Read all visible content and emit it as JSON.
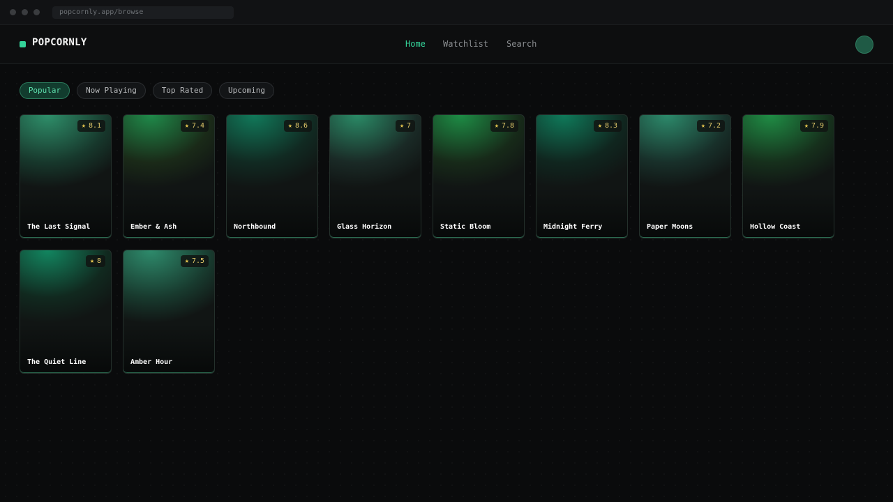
{
  "browser": {
    "url": "popcornly.app/browse"
  },
  "app": {
    "name": "POPCORNLY",
    "accent": "#34d399"
  },
  "nav": {
    "home": "Home",
    "watchlist": "Watchlist",
    "search": "Search"
  },
  "filters": [
    "Popular",
    "Now Playing",
    "Top Rated",
    "Upcoming"
  ],
  "active_filter": "Popular",
  "movies": [
    {
      "title": "The Last Signal",
      "rating": "8.1"
    },
    {
      "title": "Ember & Ash",
      "rating": "7.4"
    },
    {
      "title": "Northbound",
      "rating": "8.6"
    },
    {
      "title": "Glass Horizon",
      "rating": "7"
    },
    {
      "title": "Static Bloom",
      "rating": "7.8"
    },
    {
      "title": "Midnight Ferry",
      "rating": "8.3"
    },
    {
      "title": "Paper Moons",
      "rating": "7.2"
    },
    {
      "title": "Hollow Coast",
      "rating": "7.9"
    },
    {
      "title": "The Quiet Line",
      "rating": "8"
    },
    {
      "title": "Amber Hour",
      "rating": "7.5"
    }
  ],
  "icons": {
    "rating": "star-icon",
    "profile": "avatar"
  }
}
